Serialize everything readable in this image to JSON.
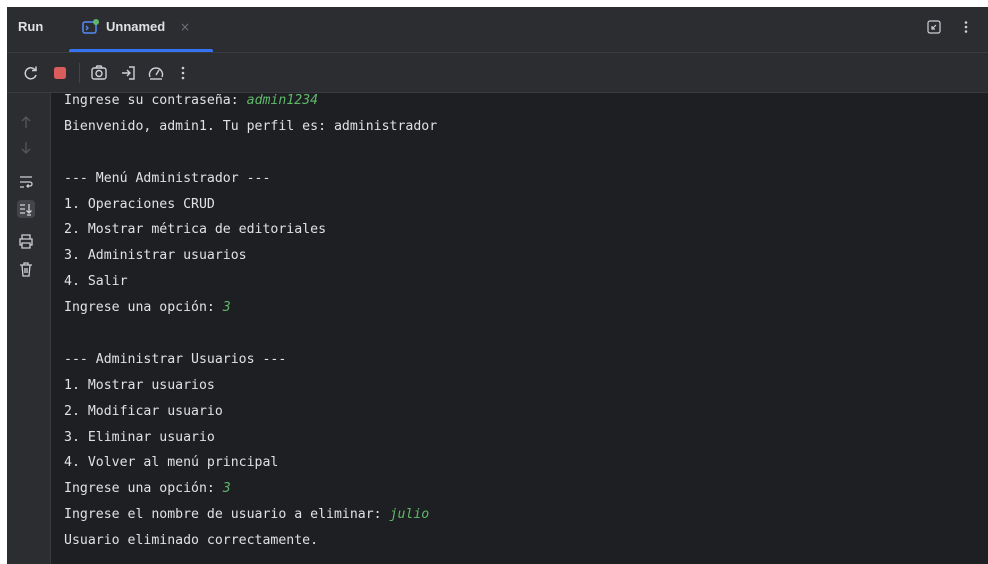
{
  "header": {
    "run_label": "Run",
    "tab_title": "Unnamed",
    "tab_close": "×"
  },
  "icons": {
    "tab_icon": "console-run-config-icon",
    "restore_icon": "restore-layout-icon",
    "more_icon": "more-vertical-icon",
    "toolbar": [
      "rerun-icon",
      "stop-icon",
      "screenshot-icon",
      "exit-icon",
      "profiler-icon",
      "more-vertical-icon"
    ],
    "gutter": [
      "arrow-up-icon",
      "arrow-down-icon",
      "soft-wrap-icon",
      "scroll-to-end-icon",
      "print-icon",
      "trash-icon"
    ]
  },
  "colors": {
    "accent": "#3574f0",
    "input_text": "#5fb86a",
    "stop": "#db5c5c",
    "background": "#1e1f22",
    "panel": "#2b2d30"
  },
  "console": {
    "lines": [
      {
        "text": "Ingrese su contraseña: ",
        "input": "admin1234"
      },
      {
        "text": "Bienvenido, admin1. Tu perfil es: administrador",
        "input": ""
      },
      {
        "text": "",
        "input": ""
      },
      {
        "text": "--- Menú Administrador ---",
        "input": ""
      },
      {
        "text": "1. Operaciones CRUD",
        "input": ""
      },
      {
        "text": "2. Mostrar métrica de editoriales",
        "input": ""
      },
      {
        "text": "3. Administrar usuarios",
        "input": ""
      },
      {
        "text": "4. Salir",
        "input": ""
      },
      {
        "text": "Ingrese una opción: ",
        "input": "3"
      },
      {
        "text": "",
        "input": ""
      },
      {
        "text": "--- Administrar Usuarios ---",
        "input": ""
      },
      {
        "text": "1. Mostrar usuarios",
        "input": ""
      },
      {
        "text": "2. Modificar usuario",
        "input": ""
      },
      {
        "text": "3. Eliminar usuario",
        "input": ""
      },
      {
        "text": "4. Volver al menú principal",
        "input": ""
      },
      {
        "text": "Ingrese una opción: ",
        "input": "3"
      },
      {
        "text": "Ingrese el nombre de usuario a eliminar: ",
        "input": "julio"
      },
      {
        "text": "Usuario eliminado correctamente.",
        "input": ""
      }
    ]
  }
}
